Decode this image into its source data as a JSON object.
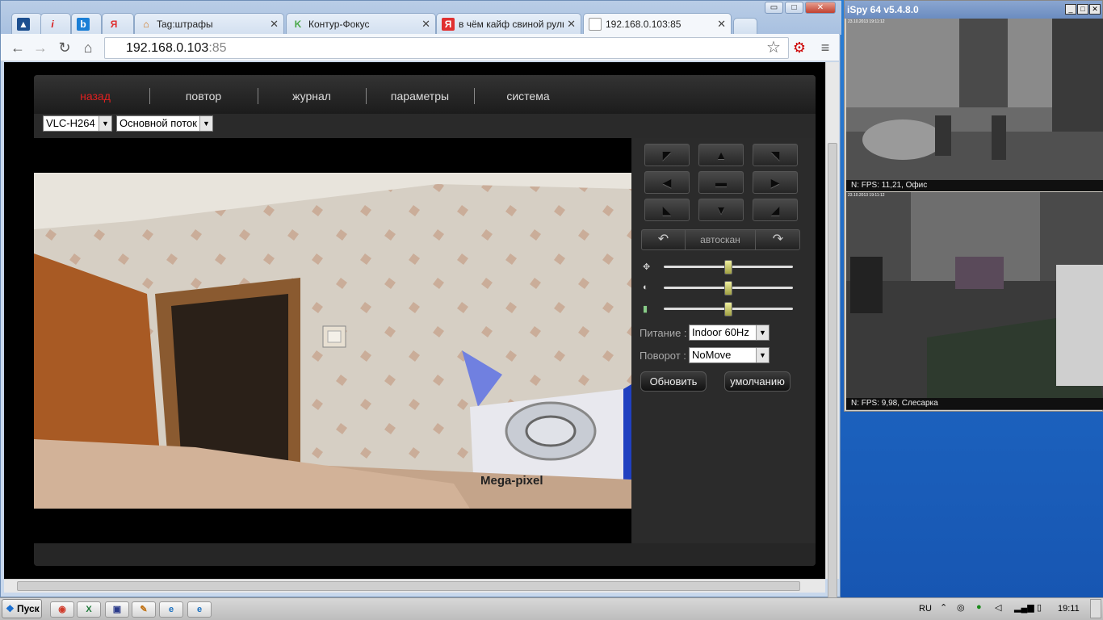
{
  "browser": {
    "tabs": [
      {
        "label": "",
        "icon": "app-icon",
        "color": "#d8402a"
      },
      {
        "label": "",
        "icon": "info-icon",
        "color": "#d81a1a"
      },
      {
        "label": "",
        "icon": "bing-icon",
        "color": "#1a7fd6"
      },
      {
        "label": "",
        "icon": "yandex-icon",
        "color": "#e03030"
      },
      {
        "label": "Tag:штрафы",
        "icon": "home-icon",
        "color": "#d07010"
      },
      {
        "label": "Контур-Фокус",
        "icon": "kontur-icon",
        "color": "#4aa84a"
      },
      {
        "label": "в чём кайф свиной рульки",
        "icon": "yandex-icon",
        "color": "#e03030"
      },
      {
        "label": "192.168.0.103:85",
        "icon": "page-icon",
        "color": "#888888"
      }
    ],
    "url_host": "192.168.0.103",
    "url_port": ":85",
    "window_controls": {
      "minimize": "▭",
      "maximize": "□",
      "close": "✕"
    }
  },
  "camera_ui": {
    "menu": [
      "назад",
      "повтор",
      "журнал",
      "параметры",
      "система"
    ],
    "active_menu": "назад",
    "codec": "VLC-H264",
    "stream": "Основной поток",
    "ptz_buttons": [
      "up-left",
      "up",
      "up-right",
      "left",
      "center",
      "right",
      "down-left",
      "down",
      "down-right"
    ],
    "autoscan": "автоскан",
    "power_label": "Питание :",
    "power_value": "Indoor 60Hz",
    "rotate_label": "Поворот :",
    "rotate_value": "NoMove",
    "refresh_button": "Обновить",
    "default_button": "умолчанию",
    "sliders": [
      {
        "name": "brightness",
        "value": 0.5
      },
      {
        "name": "contrast",
        "value": 0.5
      },
      {
        "name": "saturation",
        "value": 0.5
      }
    ],
    "video_overlay_text": "Mega-pixel"
  },
  "ispy": {
    "title": "iSpy 64 v5.4.8.0",
    "cams": [
      {
        "label": "N: FPS: 11,21, Офис",
        "timestamp": "23.10.2013 19:11:12"
      },
      {
        "label": "N: FPS: 9,98, Слесарка",
        "timestamp": "23.10.2013 19:11:12"
      }
    ]
  },
  "taskbar": {
    "start": "Пуск",
    "lang": "RU",
    "time": "19:11"
  }
}
